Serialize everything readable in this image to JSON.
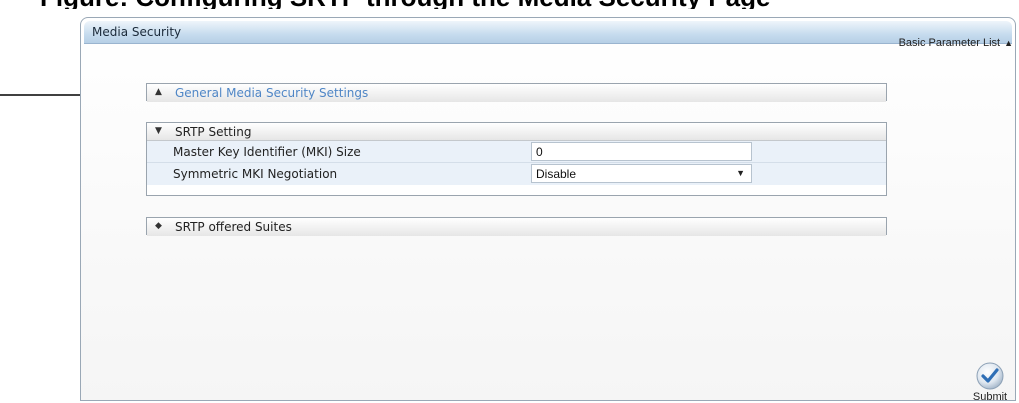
{
  "page": {
    "top_caption_fragment": "Figure: Configuring SRTP through the Media Security Page"
  },
  "panel": {
    "title": "Media Security",
    "param_list_label": "Basic Parameter List",
    "param_list_icon": "triangle-up-icon"
  },
  "groups": {
    "general": {
      "label": "General Media Security Settings",
      "state": "collapsed",
      "icon": "triangle-up-icon",
      "link_color": "#4f86c6"
    },
    "srtp_setting": {
      "label": "SRTP Setting",
      "state": "expanded",
      "icon": "triangle-down-icon",
      "rows": [
        {
          "label": "Master Key Identifier (MKI) Size",
          "value": "0",
          "type": "text"
        },
        {
          "label": "Symmetric MKI Negotiation",
          "value": "Disable",
          "type": "select"
        }
      ]
    },
    "offered_suites": {
      "label": "SRTP offered Suites",
      "state": "collapsed",
      "icon": "diamond-icon"
    }
  },
  "submit": {
    "label": "Submit",
    "icon": "checkmark-icon"
  },
  "colors": {
    "header_blue": "#c7dcee",
    "row_bg": "#eaf1f9",
    "border": "#9aa4ae"
  }
}
